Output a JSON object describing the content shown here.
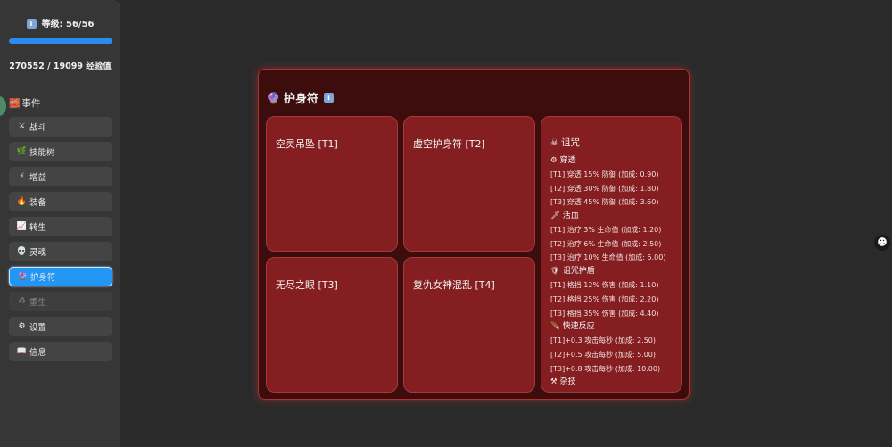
{
  "sidebar": {
    "level_label": "等级: 56/56",
    "level_icon": "info-icon",
    "xp_fill_fraction": 1.0,
    "xp_text": "270552 / 19099 经验值",
    "events_label": "事件",
    "events_icon": "🧱",
    "items": [
      {
        "icon": "⚔",
        "label": "战斗"
      },
      {
        "icon": "🌿",
        "label": "技能树"
      },
      {
        "icon": "⚡",
        "label": "增益"
      },
      {
        "icon": "🔥",
        "label": "装备"
      },
      {
        "icon": "📈",
        "label": "转生"
      },
      {
        "icon": "💀",
        "label": "灵魂"
      },
      {
        "icon": "🔮",
        "label": "护身符"
      },
      {
        "icon": "♻",
        "label": "重生"
      },
      {
        "icon": "⚙",
        "label": "设置"
      },
      {
        "icon": "📖",
        "label": "信息"
      }
    ],
    "active_index": 6,
    "disabled_index": 7
  },
  "panel": {
    "title_icon": "🔮",
    "title": "护身符",
    "info_chip": "i",
    "cards": [
      {
        "title": "空灵吊坠 [T1]"
      },
      {
        "title": "虚空护身符 [T2]"
      },
      {
        "title": "无尽之眼 [T3]"
      },
      {
        "title": "复仇女神混乱 [T4]"
      }
    ],
    "curse": {
      "icon": "☠",
      "title": "诅咒",
      "groups": [
        {
          "icon": "⚙",
          "title": "穿透",
          "lines": [
            "[T1] 穿透 15% 防御 (加成: 0.90)",
            "[T2] 穿透 30% 防御 (加成: 1.80)",
            "[T3] 穿透 45% 防御 (加成: 3.60)"
          ]
        },
        {
          "icon": "🗡",
          "title": "活血",
          "lines": [
            "[T1] 治疗 3% 生命值 (加成: 1.20)",
            "[T2] 治疗 6% 生命值 (加成: 2.50)",
            "[T3] 治疗 10% 生命值 (加成: 5.00)"
          ]
        },
        {
          "icon": "🛡",
          "title": "诅咒护盾",
          "lines": [
            "[T1] 格挡 12% 伤害 (加成: 1.10)",
            "[T2] 格挡 25% 伤害 (加成: 2.20)",
            "[T3] 格挡 35% 伤害 (加成: 4.40)"
          ]
        },
        {
          "icon": "🪶",
          "title": "快速反应",
          "lines": [
            "[T1]+0.3 攻击每秒 (加成: 2.50)",
            "[T2]+0.5 攻击每秒 (加成: 5.00)",
            "[T3]+0.8 攻击每秒 (加成: 10.00)"
          ]
        },
        {
          "icon": "⚒",
          "title": "杂技",
          "lines": []
        }
      ]
    }
  },
  "floating_icon": "skull-icon"
}
